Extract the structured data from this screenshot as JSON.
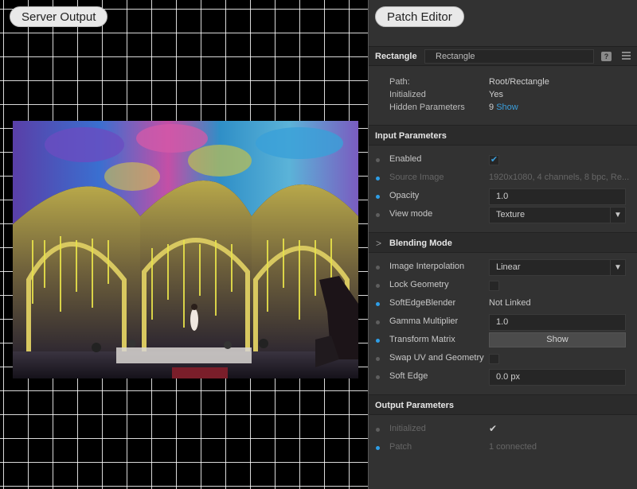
{
  "server_output": {
    "title": "Server Output"
  },
  "patch_editor": {
    "title": "Patch Editor",
    "node_type": "Rectangle",
    "node_name": "Rectangle",
    "help_icon": "help-icon",
    "menu_icon": "menu-icon",
    "info": [
      {
        "key": "Path:",
        "value": "Root/Rectangle"
      },
      {
        "key": "Initialized",
        "value": "Yes"
      },
      {
        "key": "Hidden Parameters",
        "value": "9",
        "link": "Show"
      }
    ],
    "input_section": {
      "title": "Input Parameters",
      "enabled": {
        "label": "Enabled",
        "checked": true
      },
      "source_image": {
        "label": "Source Image",
        "value": "1920x1080, 4 channels, 8 bpc, Re..."
      },
      "opacity": {
        "label": "Opacity",
        "value": "1.0"
      },
      "view_mode": {
        "label": "View mode",
        "value": "Texture"
      }
    },
    "blending_section": {
      "title": "Blending Mode",
      "image_interpolation": {
        "label": "Image Interpolation",
        "value": "Linear"
      },
      "lock_geometry": {
        "label": "Lock Geometry",
        "checked": false
      },
      "soft_edge_blender": {
        "label": "SoftEdgeBlender",
        "value": "Not Linked"
      },
      "gamma_multiplier": {
        "label": "Gamma Multiplier",
        "value": "1.0"
      },
      "transform_matrix": {
        "label": "Transform Matrix",
        "button": "Show"
      },
      "swap_uv": {
        "label": "Swap UV and Geometry",
        "checked": false
      },
      "soft_edge": {
        "label": "Soft Edge",
        "value": "0.0 px"
      }
    },
    "output_section": {
      "title": "Output Parameters",
      "initialized": {
        "label": "Initialized",
        "value": "✔"
      },
      "patch": {
        "label": "Patch",
        "value": "1 connected"
      }
    }
  },
  "colors": {
    "accent": "#2e9ee6",
    "panel_bg": "#323232",
    "header_bg": "#2b2b2b"
  }
}
